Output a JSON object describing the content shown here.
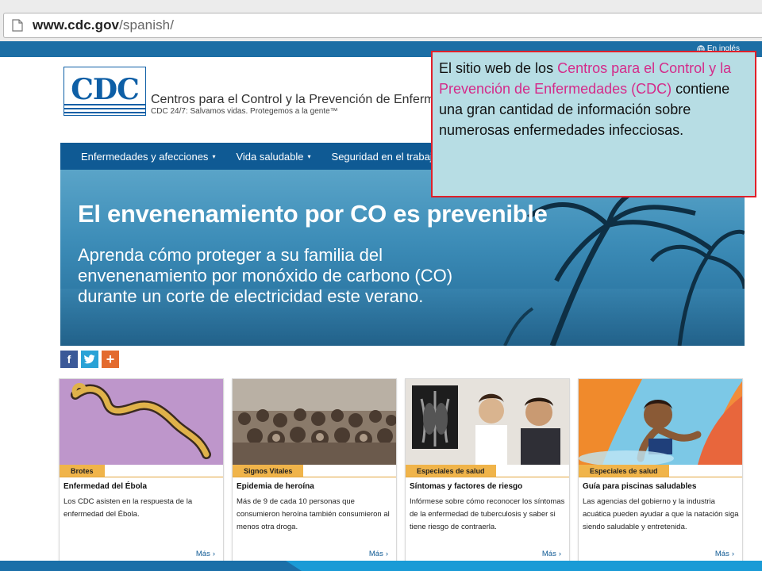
{
  "browser": {
    "url_host": "www.cdc.gov",
    "url_path": "/spanish/"
  },
  "header": {
    "language_link": "En inglés",
    "logo_text": "CDC",
    "org_name": "Centros para el Control y la Prevención de Enfermedades",
    "tagline": "CDC 24/7: Salvamos vidas. Protegemos a la gente™"
  },
  "nav": {
    "items": [
      {
        "label": "Enfermedades y afecciones"
      },
      {
        "label": "Vida saludable"
      },
      {
        "label": "Seguridad en el trabajo"
      }
    ]
  },
  "hero": {
    "title": "El envenenamiento por CO es prevenible",
    "body": "Aprenda cómo proteger a su familia del envenenamiento por monóxido de carbono (CO) durante un corte de electricidad este verano."
  },
  "social": {
    "facebook": "f",
    "plus": "+"
  },
  "cards": [
    {
      "tag": "Brotes",
      "title": "Enfermedad del Ébola",
      "desc": "Los CDC asisten en la respuesta de la enfermedad del Ébola.",
      "more": "Más"
    },
    {
      "tag": "Signos Vitales",
      "title": "Epidemia de heroína",
      "desc": "Más de 9 de cada 10 personas que consumieron heroína también consumieron al menos otra droga.",
      "more": "Más"
    },
    {
      "tag": "Especiales de salud",
      "title": "Síntomas y factores de riesgo",
      "desc": "Infórmese sobre cómo reconocer los síntomas de la enfermedad de tuberculosis y saber si tiene riesgo de contraerla.",
      "more": "Más"
    },
    {
      "tag": "Especiales de salud",
      "title": "Guía para piscinas saludables",
      "desc": "Las agencias del gobierno y la industria acuática pueden ayudar a que la natación siga siendo saludable y entretenida.",
      "more": "Más"
    }
  ],
  "callout": {
    "part1": "El sitio web de los ",
    "highlight": "Centros para el Control y la Prevención de Enfermedades (CDC)",
    "part2": " contiene una gran cantidad de información sobre numerosas enfermedades infecciosas."
  },
  "colors": {
    "cdc_blue": "#0f5a94",
    "tag_orange": "#f0b44a",
    "callout_bg": "#b7dde4",
    "callout_border": "#e0202a",
    "callout_highlight": "#d42b8a"
  }
}
